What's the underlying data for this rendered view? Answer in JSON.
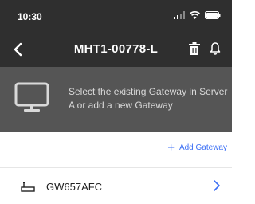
{
  "status_bar": {
    "time": "10:30",
    "icons": [
      "signal-icon",
      "wifi-icon",
      "battery-icon"
    ]
  },
  "nav": {
    "title": "MHT1-00778-L",
    "back_icon": "chevron-left-icon",
    "actions": [
      "trash-icon",
      "bell-icon"
    ]
  },
  "banner": {
    "icon": "monitor-icon",
    "text": "Select the existing Gateway in Server A or add a new Gateway"
  },
  "add_gateway": {
    "icon": "plus",
    "label": "Add Gateway"
  },
  "gateways": [
    {
      "name": "GW657AFC",
      "icon": "gateway-icon"
    }
  ],
  "colors": {
    "header_bg": "#2f2f2f",
    "banner_bg": "#555555",
    "accent": "#3b6ff5"
  }
}
